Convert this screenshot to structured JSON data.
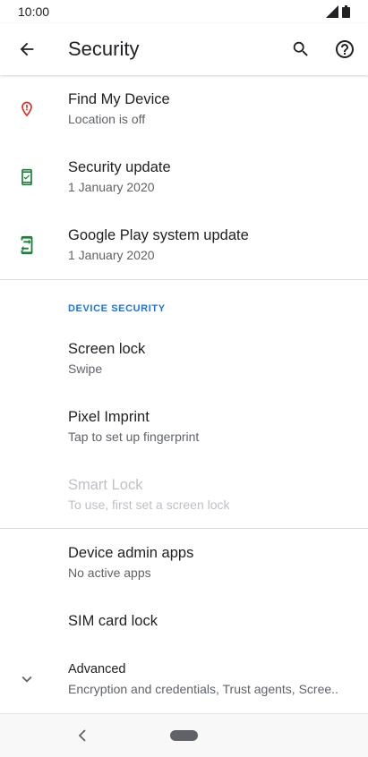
{
  "status_bar": {
    "time": "10:00"
  },
  "header": {
    "title": "Security"
  },
  "items_top": [
    {
      "title": "Find My Device",
      "subtitle": "Location is off",
      "icon": "location-alert-icon",
      "icon_color": "#d93025"
    },
    {
      "title": "Security update",
      "subtitle": "1 January 2020",
      "icon": "phone-check-icon",
      "icon_color": "#188038"
    },
    {
      "title": "Google Play system update",
      "subtitle": "1 January 2020",
      "icon": "phone-update-icon",
      "icon_color": "#188038"
    }
  ],
  "device_security": {
    "header": "DEVICE SECURITY",
    "items": [
      {
        "title": "Screen lock",
        "subtitle": "Swipe"
      },
      {
        "title": "Pixel Imprint",
        "subtitle": "Tap to set up fingerprint"
      },
      {
        "title": "Smart Lock",
        "subtitle": "To use, first set a screen lock",
        "disabled": true
      }
    ]
  },
  "items_bottom": [
    {
      "title": "Device admin apps",
      "subtitle": "No active apps"
    },
    {
      "title": "SIM card lock"
    },
    {
      "title": "Advanced",
      "subtitle": "Encryption and credentials, Trust agents, Scree.."
    }
  ],
  "colors": {
    "accent": "#1a73e8",
    "divider": "#dadce0",
    "disabled": "#bdc1c6"
  }
}
